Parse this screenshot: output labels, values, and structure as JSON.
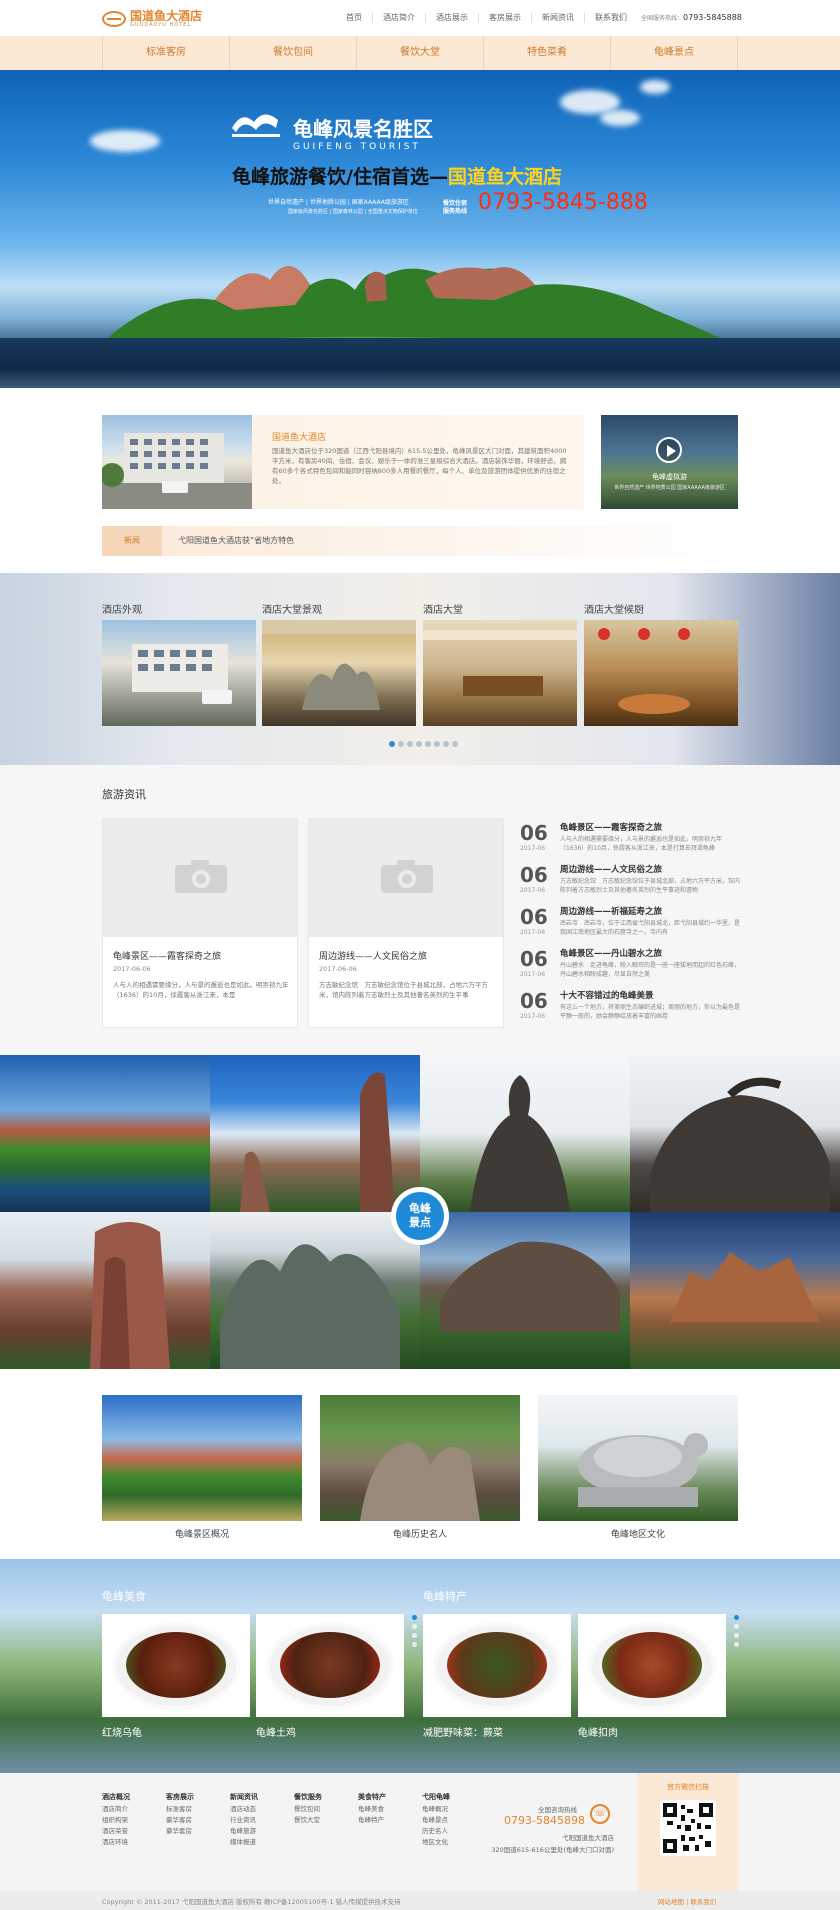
{
  "header": {
    "logo_cn": "国道鱼大酒店",
    "logo_en": "GUODAOYU HOTEL",
    "nav": [
      "首页",
      "酒店简介",
      "酒店展示",
      "客房展示",
      "新闻资讯",
      "联系我们"
    ],
    "hotline_label": "全国服务热线：",
    "hotline": "0793-5845888"
  },
  "subnav": [
    "标准客房",
    "餐饮包间",
    "餐饮大堂",
    "特色菜肴",
    "龟峰景点"
  ],
  "banner": {
    "title": "龟峰风景名胜区",
    "title_en": "GUIFENG TOURIST",
    "tagline_pre": "龟峰旅游餐饮/住宿首选—",
    "tagline_hotel": "国道鱼大酒店",
    "info1": "世界自然遗产 | 世界地质公园 | 国家AAAAA级旅游区",
    "info2": "国家级风景名胜区 | 国家森林公园 | 全国重点文物保护单位",
    "hotline_label": "餐饮住宿服务热线",
    "phone": "0793-5845-888"
  },
  "intro": {
    "title": "国道鱼大酒店",
    "text": "国道鱼大酒店位于320国道（江西弋阳县境内）615.5公里处，龟峰风景区大门对面，其建筑面积4000平方米，有客房40间、住宿、会议、娱乐于一体的准三星级综合大酒店。酒店装饰华丽，环境舒适，拥有60多个各式特色包间和能同时容纳800多人用餐的餐厅，每个人、单位及旅游团体提供优质的住宿之处。",
    "video_title": "龟峰虚拟游",
    "video_sub": "世界自然遗产 世界地质公园 国家AAAAA级旅游区"
  },
  "news_bar": {
    "label": "新闻",
    "text": "弋阳国道鱼大酒店获“省地方特色"
  },
  "gallery": {
    "items": [
      "酒店外观",
      "酒店大堂景观",
      "酒店大堂",
      "酒店大堂候厨"
    ],
    "dots": 8,
    "active": 0
  },
  "travel": {
    "heading": "旅游资讯",
    "cards": [
      {
        "title": "龟峰景区——霞客探奇之旅",
        "date": "2017-06-06",
        "desc": "人与人的相遇需要缘分，人与景的邂逅也是如此。明崇祯九年（1636）的10月，徐霞客从浙江来，本是"
      },
      {
        "title": "周边游线——人文民俗之旅",
        "date": "2017-06-06",
        "desc": "方志敏纪念馆　方志敏纪念馆位于县城北部，占地六万平方米，馆内陈列着方志敏烈士及其他著名英烈的生平事"
      }
    ],
    "list": [
      {
        "day": "06",
        "ym": "2017-06",
        "title": "龟峰景区——霞客探奇之旅",
        "desc": "人与人的相遇需要缘分，人与景的邂逅也是如此。明崇祯九年（1636）的10月，徐霞客从浙江来，本是打算去拜谒龟峰"
      },
      {
        "day": "06",
        "ym": "2017-06",
        "title": "周边游线——人文民俗之旅",
        "desc": "方志敏纪念馆　方志敏纪念馆位于县城北部，占地六万平方米，馆内陈列着方志敏烈士及其他著名英烈的生平事迹和遗物"
      },
      {
        "day": "06",
        "ym": "2017-06",
        "title": "周边游线——祈福延寿之旅",
        "desc": "南岩寺　南岩寺，位于江西省弋阳县城北，距弋阳县城约一华里，是我国江南地区最大的石窟寺之一，寺内有"
      },
      {
        "day": "06",
        "ym": "2017-06",
        "title": "龟峰景区——丹山碧水之旅",
        "desc": "丹山碧水　走进龟峰，映入眼帘的是一座一座拔地而起的红色石峰，丹山碧水相映成趣，尽显自然之美"
      },
      {
        "day": "06",
        "ym": "2017-06",
        "title": "十大不容错过的龟峰美景",
        "desc": "有这么一个地方，将美丽生态编织进城；美丽的地方，你以为最色是平静一般的，她会静静绽放着丰富的画卷"
      }
    ]
  },
  "scenic": {
    "badge": [
      "龟峰",
      "景点"
    ]
  },
  "culture": [
    "龟峰景区概况",
    "龟峰历史名人",
    "龟峰地区文化"
  ],
  "food": {
    "left_heading": "龟峰美食",
    "right_heading": "龟峰特产",
    "dishes": [
      "红烧乌龟",
      "龟峰土鸡",
      "减肥野味菜：蕨菜",
      "龟峰扣肉"
    ]
  },
  "footer": {
    "cols": [
      {
        "head": "酒店概况",
        "items": [
          "酒店简介",
          "组织构架",
          "酒店荣誉",
          "酒店环境"
        ]
      },
      {
        "head": "客房展示",
        "items": [
          "标准客房",
          "豪华客房",
          "豪华套房"
        ]
      },
      {
        "head": "新闻资讯",
        "items": [
          "酒店动态",
          "行业资讯",
          "龟峰旅游",
          "媒体报道"
        ]
      },
      {
        "head": "餐饮服务",
        "items": [
          "餐饮包间",
          "餐饮大堂"
        ]
      },
      {
        "head": "美食特产",
        "items": [
          "龟峰美食",
          "龟峰特产"
        ]
      },
      {
        "head": "弋阳龟峰",
        "items": [
          "龟峰概况",
          "龟峰景点",
          "历史名人",
          "地区文化"
        ]
      }
    ],
    "tel_label": "全国咨询热线",
    "tel": "0793-5845898",
    "addr1": "弋阳国道鱼大酒店",
    "addr2": "320国道615-616公里处(龟峰大门口对面)",
    "wx_title": "官方微信扫描",
    "copyright": "Copyright © 2011-2017 弋阳国道鱼大酒店 版权所有 赣ICP备12005100号-1 猎人传媒提供技术支持",
    "links": "网站地图 | 联系我们"
  },
  "colors": {
    "accent": "#e0862f",
    "subnav_bg": "#fbe8d5",
    "blue": "#1e8ad8",
    "phone_red": "#ff2d14"
  }
}
